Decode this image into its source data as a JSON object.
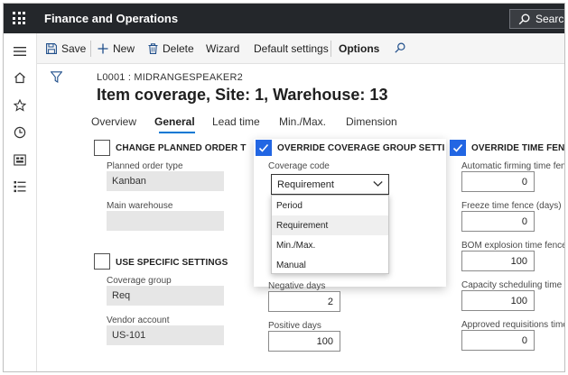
{
  "topbar": {
    "app_title": "Finance and Operations",
    "search_label": "Search",
    "waffle_icon": "waffle-grid-icon"
  },
  "leftnav": {
    "items": [
      {
        "icon": "hamburger-menu-icon"
      },
      {
        "icon": "home-icon"
      },
      {
        "icon": "star-favorites-icon"
      },
      {
        "icon": "clock-recent-icon"
      },
      {
        "icon": "workspaces-icon"
      },
      {
        "icon": "modules-list-icon"
      }
    ]
  },
  "actionbar": {
    "save_label": "Save",
    "new_label": "New",
    "delete_label": "Delete",
    "wizard_label": "Wizard",
    "default_settings_label": "Default settings",
    "options_label": "Options"
  },
  "header": {
    "breadcrumb": "L0001 : MIDRANGESPEAKER2",
    "title": "Item coverage, Site: 1, Warehouse: 13"
  },
  "tabs": [
    {
      "label": "Overview",
      "active": false
    },
    {
      "label": "General",
      "active": true
    },
    {
      "label": "Lead time",
      "active": false
    },
    {
      "label": "Min./Max.",
      "active": false
    },
    {
      "label": "Dimension",
      "active": false
    }
  ],
  "col1": {
    "change_planned_order": {
      "label": "CHANGE PLANNED ORDER TYPI",
      "checked": false
    },
    "planned_order_type": {
      "label": "Planned order type",
      "value": "Kanban"
    },
    "main_warehouse": {
      "label": "Main warehouse",
      "value": ""
    },
    "use_specific": {
      "label": "USE SPECIFIC SETTINGS",
      "checked": false
    },
    "coverage_group": {
      "label": "Coverage group",
      "value": "Req"
    },
    "vendor_account": {
      "label": "Vendor account",
      "value": "US-101"
    }
  },
  "col2": {
    "override_coverage": {
      "label": "OVERRIDE COVERAGE GROUP SETTINGS",
      "checked": true
    },
    "coverage_code": {
      "label": "Coverage code",
      "value": "Requirement",
      "options": [
        "Period",
        "Requirement",
        "Min./Max.",
        "Manual"
      ],
      "selected_index": 1
    },
    "negative_days": {
      "label": "Negative days",
      "value": "2"
    },
    "positive_days": {
      "label": "Positive days",
      "value": "100"
    }
  },
  "col3": {
    "override_time_fences": {
      "label": "OVERRIDE TIME FENCES",
      "checked": true
    },
    "auto_firming": {
      "label": "Automatic firming time fence",
      "value": "0"
    },
    "freeze": {
      "label": "Freeze time fence (days)",
      "value": "0"
    },
    "bom_explosion": {
      "label": "BOM explosion time fence",
      "value": "100"
    },
    "capacity_scheduling": {
      "label": "Capacity scheduling time fence",
      "value": "100"
    },
    "approved_requisitions": {
      "label": "Approved requisitions time fence",
      "value": "0"
    }
  },
  "colors": {
    "topbar": "#24272b",
    "accent": "#0078d4",
    "checkbox_checked": "#2266e3",
    "readonly_field": "#e6e6e6"
  }
}
